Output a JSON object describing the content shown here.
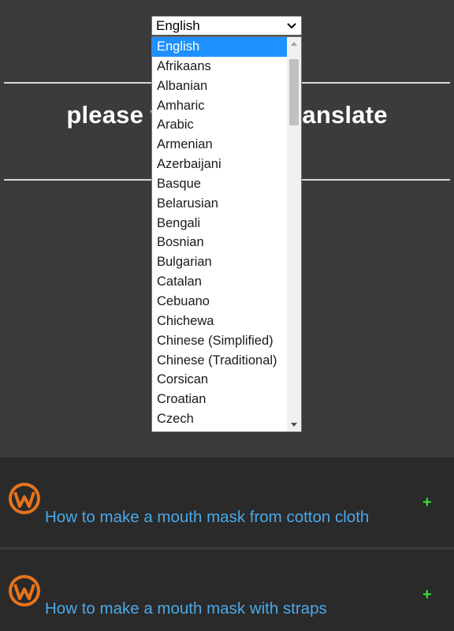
{
  "page": {
    "wait_left": "please wa",
    "wait_right": "translate"
  },
  "language_select": {
    "selected": "English",
    "options": [
      "English",
      "Afrikaans",
      "Albanian",
      "Amharic",
      "Arabic",
      "Armenian",
      "Azerbaijani",
      "Basque",
      "Belarusian",
      "Bengali",
      "Bosnian",
      "Bulgarian",
      "Catalan",
      "Cebuano",
      "Chichewa",
      "Chinese (Simplified)",
      "Chinese (Traditional)",
      "Corsican",
      "Croatian",
      "Czech"
    ]
  },
  "articles": [
    {
      "title": "How to make a mouth mask from cotton cloth",
      "expand": "+"
    },
    {
      "title": "How to make a mouth mask with straps",
      "expand": "+"
    }
  ],
  "colors": {
    "background": "#3b3b3b",
    "article_bg": "#2a2a2a",
    "link": "#4aa8e8",
    "plus": "#33dd33",
    "selected_option": "#1e90ff",
    "logo_orange": "#e8731a"
  },
  "icons": {
    "select_arrow": "chevron-down-icon",
    "logo": "w-logo-icon"
  }
}
